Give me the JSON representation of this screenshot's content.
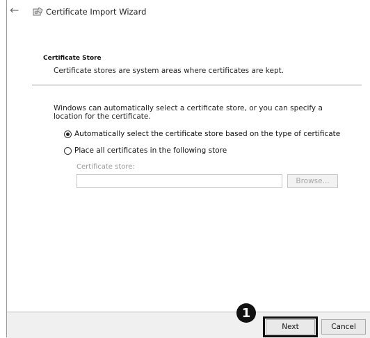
{
  "window": {
    "title": "Certificate Import Wizard",
    "back_icon": "back-arrow-icon",
    "wizard_icon": "certificate-wizard-icon"
  },
  "section": {
    "title": "Certificate Store",
    "description": "Certificate stores are system areas where certificates are kept."
  },
  "body": {
    "intro": "Windows can automatically select a certificate store, or you can specify a location for the certificate.",
    "options": [
      {
        "label": "Automatically select the certificate store based on the type of certificate",
        "selected": true
      },
      {
        "label": "Place all certificates in the following store",
        "selected": false
      }
    ],
    "store_label": "Certificate store:",
    "store_value": "",
    "browse_label": "Browse..."
  },
  "footer": {
    "next_label": "Next",
    "cancel_label": "Cancel"
  },
  "callout": {
    "number": "1"
  }
}
